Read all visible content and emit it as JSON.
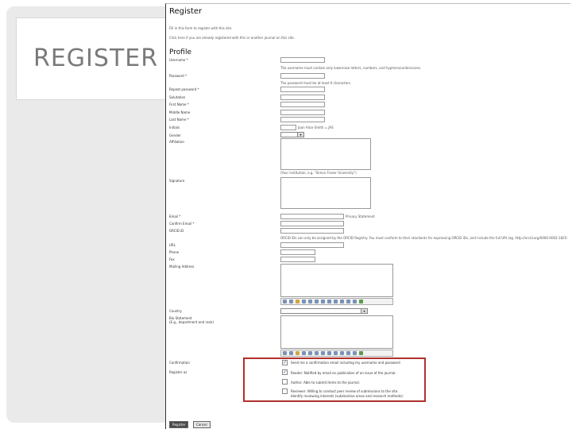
{
  "slide": {
    "title": "REGISTER"
  },
  "form": {
    "heading": "Register",
    "intro1": "Fill in this form to register with this site.",
    "intro2": "Click here if you are already registered with this or another journal on this site.",
    "section_profile": "Profile",
    "fields": [
      {
        "label": "Username *"
      },
      {
        "label": "Password *"
      },
      {
        "label": "Repeat password *"
      },
      {
        "label": "Salutation"
      },
      {
        "label": "First Name *"
      },
      {
        "label": "Middle Name"
      },
      {
        "label": "Last Name *"
      },
      {
        "label": "Initials"
      },
      {
        "label": "Gender"
      },
      {
        "label": "Affiliation"
      },
      {
        "label": "Signature"
      },
      {
        "label": "Email *"
      },
      {
        "label": "Confirm Email *"
      },
      {
        "label": "ORCID iD"
      },
      {
        "label": "URL"
      },
      {
        "label": "Phone"
      },
      {
        "label": "Fax"
      },
      {
        "label": "Mailing Address"
      },
      {
        "label": "Country"
      },
      {
        "label": "Bio Statement"
      },
      {
        "label": "(E.g., department and rank)"
      }
    ],
    "hints": {
      "username": "The username must contain only lowercase letters, numbers, and hyphens/underscores.",
      "password": "The password must be at least 6 characters.",
      "initials": "Joan Alice Smith = JAS",
      "affiliation": "(Your institution, e.g. \"Simon Fraser University\")",
      "email": "Privacy Statement",
      "orcid": "ORCID iDs can only be assigned by the ORCID Registry. You must conform to their standards for expressing ORCID iDs, and include the full URI (eg. http://orcid.org/0000-0002-1825-0097)."
    },
    "confirmation_label": "Confirmation",
    "register_as_label": "Register as",
    "checkboxes": [
      {
        "label": "Send me a confirmation email including my username and password",
        "checked": true
      },
      {
        "label": "Reader: Notified by email on publication of an issue of the journal.",
        "checked": true
      },
      {
        "label": "Author: Able to submit items to the journal.",
        "checked": false
      },
      {
        "label": "Reviewer: Willing to conduct peer review of submissions to the site.",
        "checked": false
      }
    ],
    "reviewer_interests": "Identify reviewing interests (substantive areas and research methods):",
    "buttons": {
      "register": "Register",
      "cancel": "Cancel"
    }
  },
  "colors": {
    "highlight": "#b0302d",
    "slide_bg": "#eaeaea"
  }
}
